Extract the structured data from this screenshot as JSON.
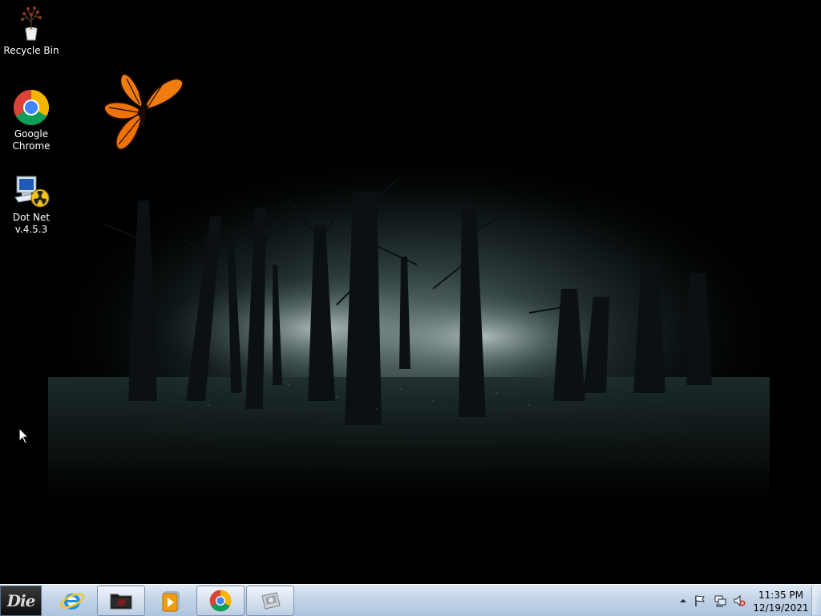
{
  "desktop": {
    "icons": [
      {
        "label": "Recycle Bin",
        "icon": "recycle-bin-icon"
      },
      {
        "label": "Google\nChrome",
        "icon": "chrome-icon"
      },
      {
        "label": "Dot Net\nv.4.5.3",
        "icon": "dotnet-installer-icon"
      }
    ],
    "wallpaper": "dark-misty-forest",
    "overlay": "butterfly-icon"
  },
  "taskbar": {
    "start_label": "Die",
    "pinned": [
      {
        "icon": "internet-explorer-icon"
      },
      {
        "icon": "file-explorer-folder-icon"
      },
      {
        "icon": "media-player-icon"
      },
      {
        "icon": "chrome-icon"
      },
      {
        "icon": "document-scanner-icon"
      }
    ],
    "tray": {
      "icons": [
        "show-hidden-icons-arrow",
        "action-center-flag-icon",
        "network-icon",
        "volume-muted-icon"
      ],
      "time": "11:35 PM",
      "date": "12/19/2021"
    }
  },
  "colors": {
    "taskbar_top": "#dfe9f5",
    "taskbar_bottom": "#aec4de",
    "desktop_bg": "#000000"
  }
}
